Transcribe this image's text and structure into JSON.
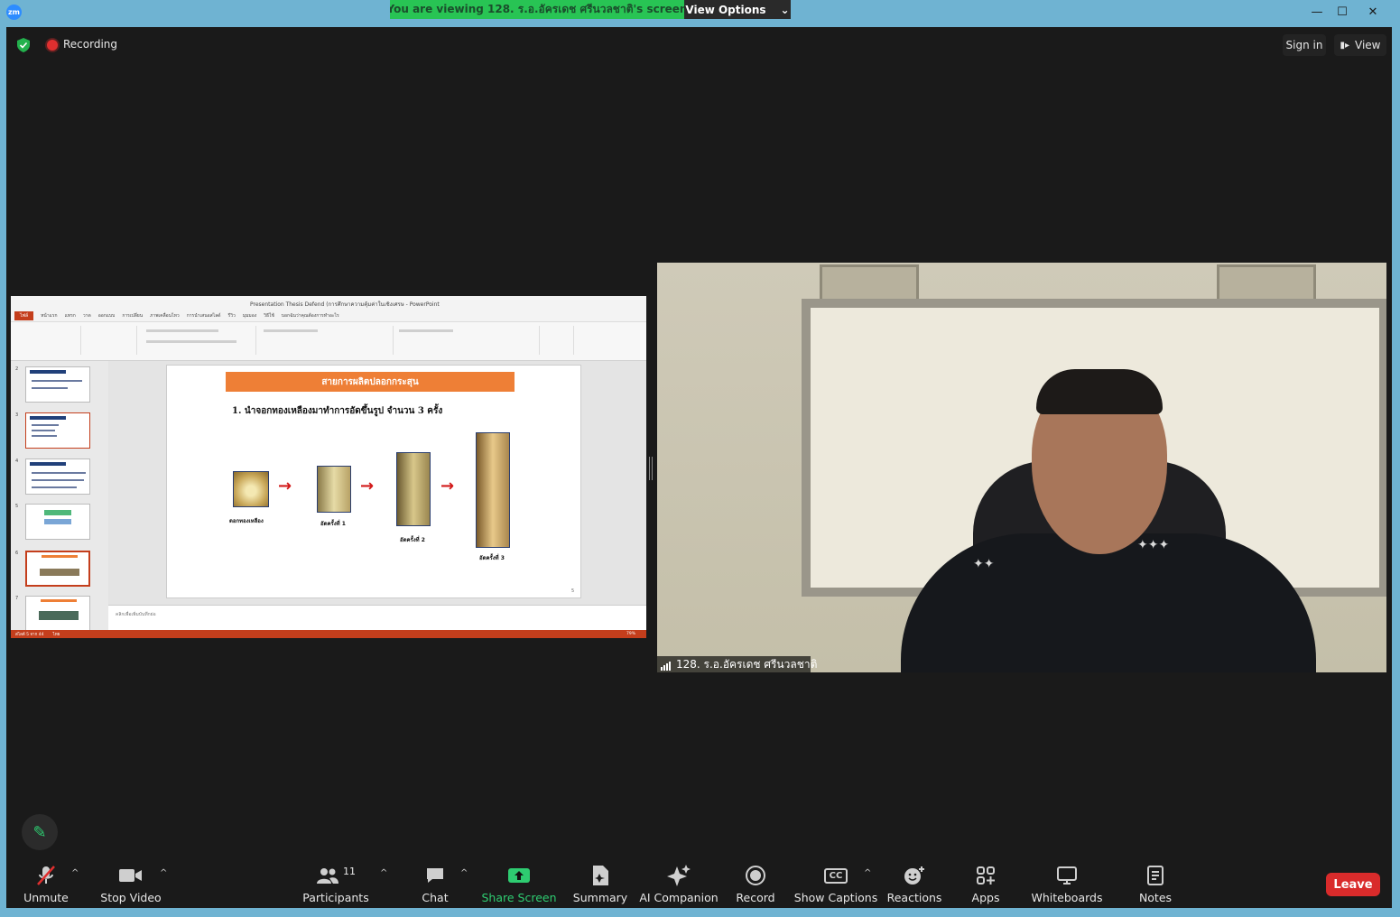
{
  "window": {
    "logo_text": "zm",
    "viewing_banner": "You are viewing 128. ร.อ.อัครเดช ศรีนวลชาติ's screen",
    "view_options_label": "View Options",
    "minimize": "—",
    "maximize": "☐",
    "close": "✕"
  },
  "topbar": {
    "recording_label": "Recording",
    "sign_in_label": "Sign in",
    "view_label": "View"
  },
  "powerpoint": {
    "title": "Presentation Thesis Defend (การศึกษาความคุ้มค่าในเชิงเศรษ - PowerPoint",
    "tabs": [
      "ไฟล์",
      "หน้าแรก",
      "แทรก",
      "วาด",
      "ออกแบบ",
      "การเปลี่ยน",
      "ภาพเคลื่อนไหว",
      "การนำเสนอสไลด์",
      "รีวิว",
      "มุมมอง",
      "วิธีใช้",
      "บอกฉันว่าคุณต้องการทำอะไร"
    ],
    "thumb_numbers": [
      "2",
      "3",
      "4",
      "5",
      "6",
      "7"
    ],
    "slide": {
      "banner": "สายการผลิตปลอกกระสุน",
      "heading": "1. นำจอกทองเหลืองมาทำการอัดขึ้นรูป จำนวน 3 ครั้ง",
      "labels": [
        "ดอกทองเหลือง",
        "อัดครั้งที่ 1",
        "อัดครั้งที่ 2",
        "อัดครั้งที่ 3"
      ],
      "number": "5"
    },
    "notes_placeholder": "คลิกเพื่อเพิ่มบันทึกย่อ",
    "status_text": "สไลด์ 5 จาก 44",
    "status_language": "ไทย",
    "zoom": "79%"
  },
  "video": {
    "participant_name": "128. ร.อ.อัครเดช ศรีนวลชาติ"
  },
  "toolbar": {
    "unmute": "Unmute",
    "stop_video": "Stop Video",
    "participants": "Participants",
    "participants_count": "11",
    "chat": "Chat",
    "share_screen": "Share Screen",
    "summary": "Summary",
    "ai_companion": "AI Companion",
    "record": "Record",
    "show_captions": "Show Captions",
    "cc_badge": "CC",
    "reactions": "Reactions",
    "apps": "Apps",
    "whiteboards": "Whiteboards",
    "notes": "Notes",
    "leave": "Leave"
  },
  "colors": {
    "accent_green": "#28c454",
    "share_green": "#2ecc71",
    "leave_red": "#d92b2b",
    "frame_blue": "#6fb3d2",
    "slide_orange": "#ee7f36"
  }
}
